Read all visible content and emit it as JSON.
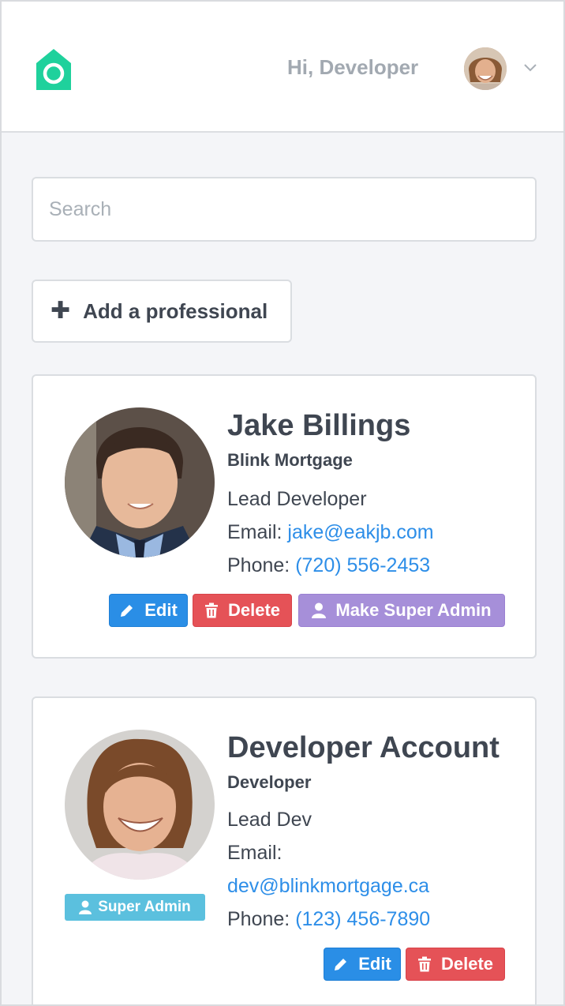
{
  "header": {
    "greeting": "Hi, Developer",
    "brand_color": "#1fd19c"
  },
  "search": {
    "placeholder": "Search",
    "value": ""
  },
  "add_button": {
    "label": "Add a professional"
  },
  "professionals": [
    {
      "name": "Jake Billings",
      "company": "Blink Mortgage",
      "title": "Lead Developer",
      "email_label": "Email:",
      "email": "jake@eakjb.com",
      "phone_label": "Phone:",
      "phone": "(720) 556-2453",
      "actions": {
        "edit": "Edit",
        "delete": "Delete",
        "make_admin": "Make Super Admin"
      }
    },
    {
      "name": "Developer Account",
      "company": "Developer",
      "title": "Lead Dev",
      "email_label": "Email:",
      "email": "dev@blinkmortgage.ca",
      "phone_label": "Phone:",
      "phone": "(123) 456-7890",
      "badge": "Super Admin",
      "actions": {
        "edit": "Edit",
        "delete": "Delete"
      }
    }
  ],
  "colors": {
    "link": "#2d8ee8",
    "edit": "#2a8ee6",
    "delete": "#e55257",
    "make_admin": "#a68fd9",
    "badge": "#5bc0de"
  }
}
